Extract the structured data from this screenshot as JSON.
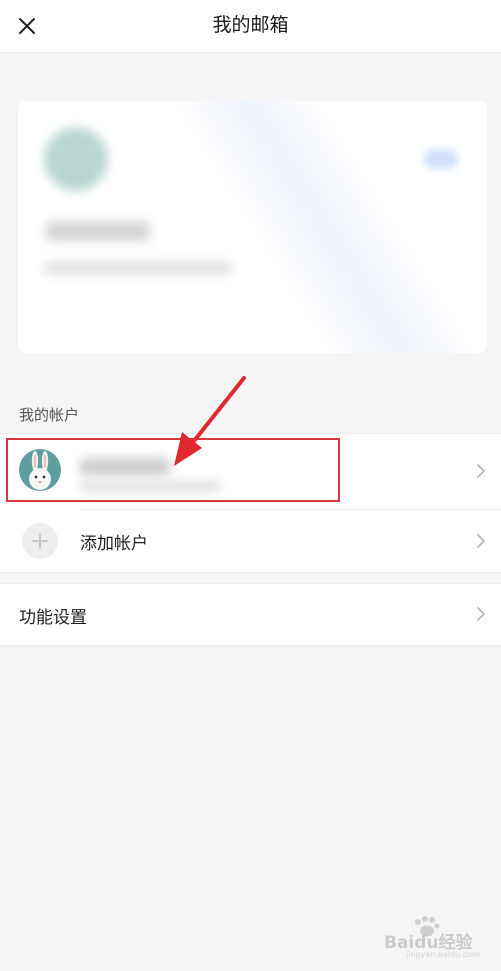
{
  "header": {
    "title": "我的邮箱",
    "close_icon": "close-icon"
  },
  "profile_card": {
    "redacted": true,
    "accent_color": "#d9e6f7"
  },
  "accounts_section": {
    "label": "我的帐户",
    "accounts": [
      {
        "avatar_icon": "rabbit-avatar",
        "name_redacted": true,
        "email_redacted": true
      }
    ],
    "add_account_label": "添加帐户"
  },
  "settings": {
    "label": "功能设置"
  },
  "annotation": {
    "highlight_color": "#d9363e",
    "pointer": "red-arrow-icon"
  },
  "watermark": {
    "brand": "Baidu经验",
    "url": "jingyan.baidu.com"
  },
  "colors": {
    "background": "#f5f5f5",
    "surface": "#ffffff",
    "divider": "#ececec",
    "text_primary": "#1f1f1f",
    "text_secondary": "#555555",
    "chevron": "#b8b8b8"
  }
}
